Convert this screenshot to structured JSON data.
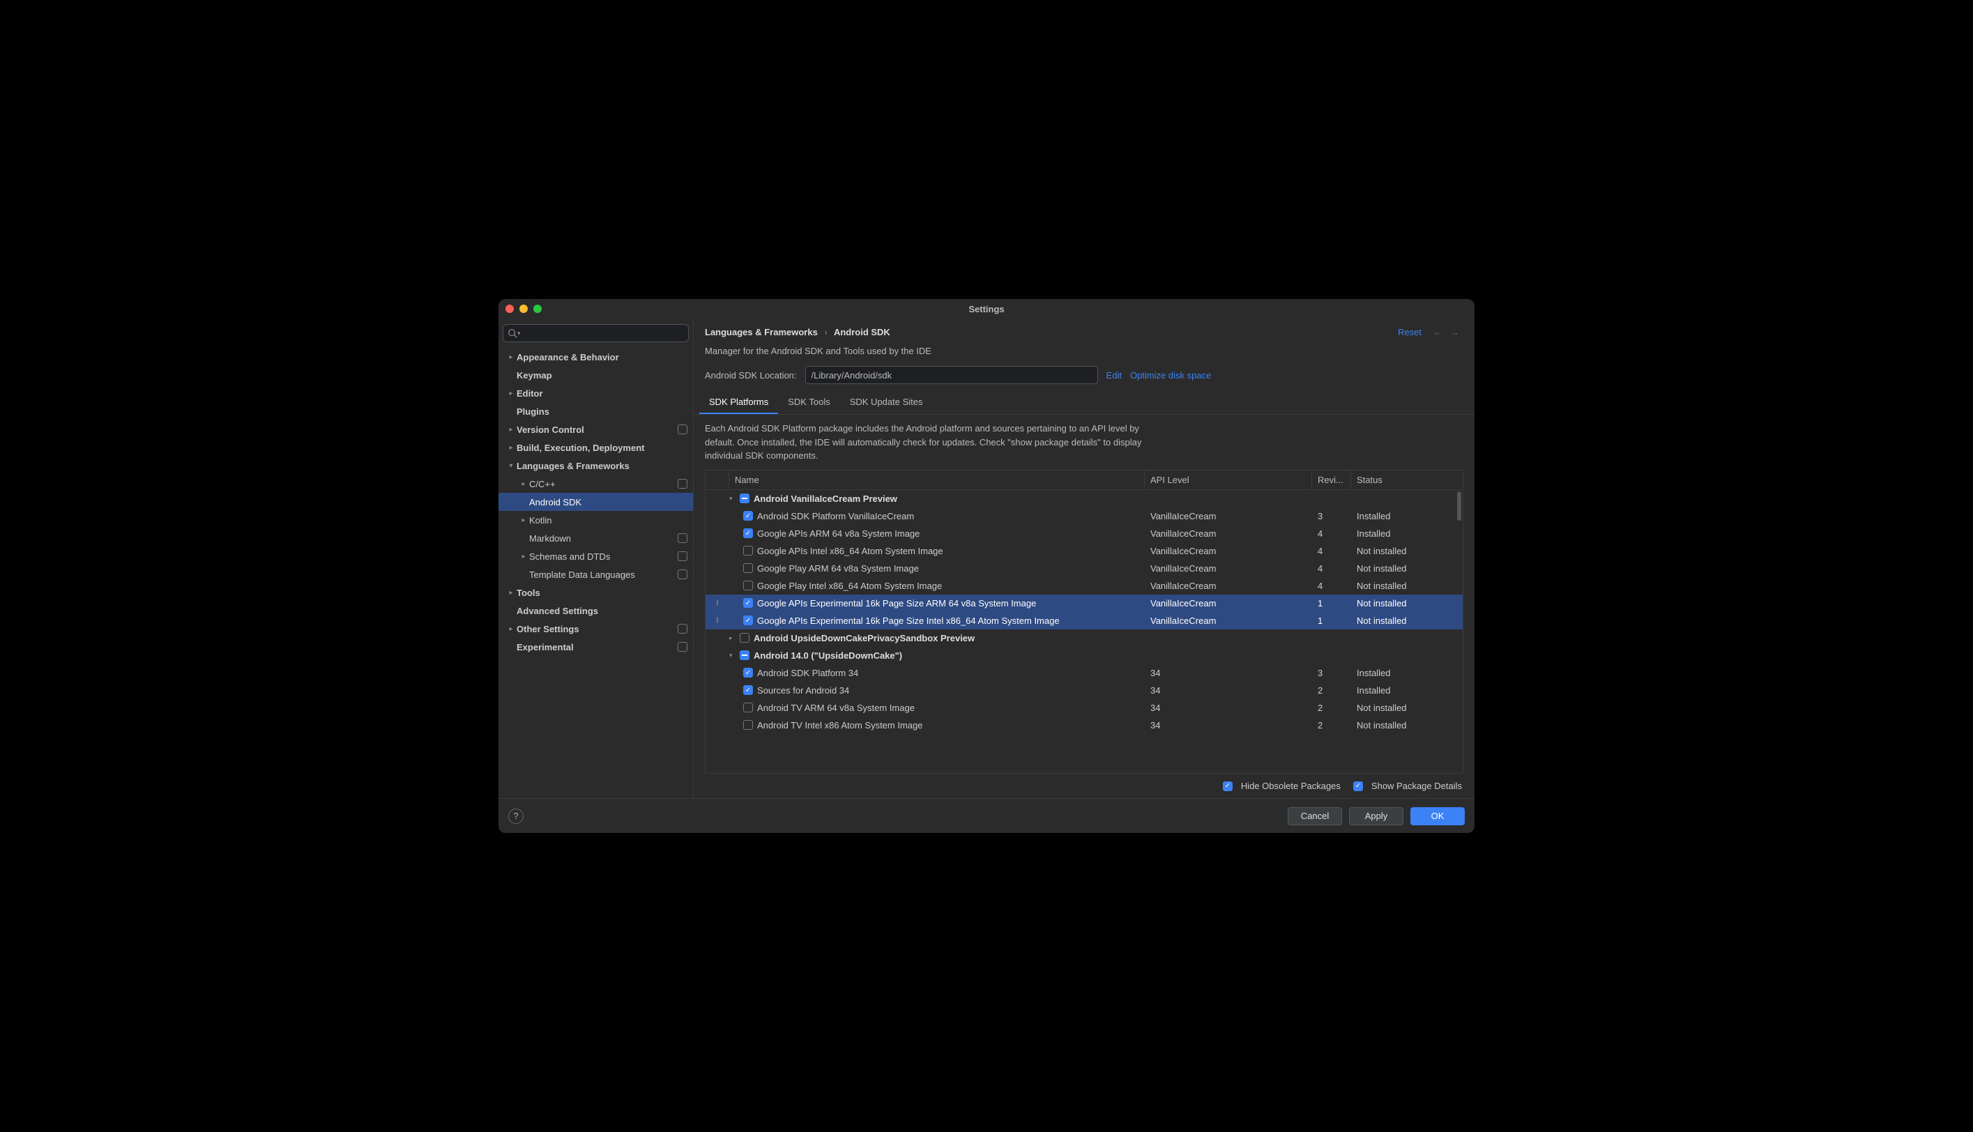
{
  "window": {
    "title": "Settings"
  },
  "search": {
    "placeholder": ""
  },
  "sidebar": {
    "items": [
      {
        "label": "Appearance & Behavior",
        "indent": 0,
        "arrow": ">",
        "bold": true
      },
      {
        "label": "Keymap",
        "indent": 0,
        "arrow": "",
        "bold": true
      },
      {
        "label": "Editor",
        "indent": 0,
        "arrow": ">",
        "bold": true
      },
      {
        "label": "Plugins",
        "indent": 0,
        "arrow": "",
        "bold": true
      },
      {
        "label": "Version Control",
        "indent": 0,
        "arrow": ">",
        "bold": true,
        "mod": true
      },
      {
        "label": "Build, Execution, Deployment",
        "indent": 0,
        "arrow": ">",
        "bold": true
      },
      {
        "label": "Languages & Frameworks",
        "indent": 0,
        "arrow": "v",
        "bold": true
      },
      {
        "label": "C/C++",
        "indent": 1,
        "arrow": ">",
        "mod": true
      },
      {
        "label": "Android SDK",
        "indent": 1,
        "arrow": "",
        "selected": true
      },
      {
        "label": "Kotlin",
        "indent": 1,
        "arrow": ">"
      },
      {
        "label": "Markdown",
        "indent": 1,
        "arrow": "",
        "mod": true
      },
      {
        "label": "Schemas and DTDs",
        "indent": 1,
        "arrow": ">",
        "mod": true
      },
      {
        "label": "Template Data Languages",
        "indent": 1,
        "arrow": "",
        "mod": true
      },
      {
        "label": "Tools",
        "indent": 0,
        "arrow": ">",
        "bold": true
      },
      {
        "label": "Advanced Settings",
        "indent": 0,
        "arrow": "",
        "bold": true
      },
      {
        "label": "Other Settings",
        "indent": 0,
        "arrow": ">",
        "bold": true,
        "mod": true
      },
      {
        "label": "Experimental",
        "indent": 0,
        "arrow": "",
        "bold": true,
        "mod": true
      }
    ]
  },
  "breadcrumb": {
    "a": "Languages & Frameworks",
    "b": "Android SDK"
  },
  "reset_label": "Reset",
  "manager_desc": "Manager for the Android SDK and Tools used by the IDE",
  "sdk_location": {
    "label": "Android SDK Location:",
    "value": "/Library/Android/sdk",
    "edit": "Edit",
    "optimize": "Optimize disk space"
  },
  "tabs": [
    "SDK Platforms",
    "SDK Tools",
    "SDK Update Sites"
  ],
  "active_tab": 0,
  "info_text": "Each Android SDK Platform package includes the Android platform and sources pertaining to an API level by default. Once installed, the IDE will automatically check for updates. Check \"show package details\" to display individual SDK components.",
  "columns": {
    "name": "Name",
    "api": "API Level",
    "rev": "Revi...",
    "status": "Status"
  },
  "rows": [
    {
      "type": "group",
      "arrow": "v",
      "cb": "partial",
      "name": "Android VanillaIceCream Preview"
    },
    {
      "type": "item",
      "cb": "checked",
      "name": "Android SDK Platform VanillaIceCream",
      "api": "VanillaIceCream",
      "rev": "3",
      "status": "Installed"
    },
    {
      "type": "item",
      "cb": "checked",
      "name": "Google APIs ARM 64 v8a System Image",
      "api": "VanillaIceCream",
      "rev": "4",
      "status": "Installed"
    },
    {
      "type": "item",
      "cb": "",
      "name": "Google APIs Intel x86_64 Atom System Image",
      "api": "VanillaIceCream",
      "rev": "4",
      "status": "Not installed"
    },
    {
      "type": "item",
      "cb": "",
      "name": "Google Play ARM 64 v8a System Image",
      "api": "VanillaIceCream",
      "rev": "4",
      "status": "Not installed"
    },
    {
      "type": "item",
      "cb": "",
      "name": "Google Play Intel x86_64 Atom System Image",
      "api": "VanillaIceCream",
      "rev": "4",
      "status": "Not installed"
    },
    {
      "type": "item",
      "cb": "checked",
      "name": "Google APIs Experimental 16k Page Size ARM 64 v8a System Image",
      "api": "VanillaIceCream",
      "rev": "1",
      "status": "Not installed",
      "dl": true,
      "selected": true
    },
    {
      "type": "item",
      "cb": "checked",
      "name": "Google APIs Experimental 16k Page Size Intel x86_64 Atom System Image",
      "api": "VanillaIceCream",
      "rev": "1",
      "status": "Not installed",
      "dl": true,
      "selected": true
    },
    {
      "type": "group",
      "arrow": ">",
      "cb": "",
      "name": "Android UpsideDownCakePrivacySandbox Preview"
    },
    {
      "type": "group",
      "arrow": "v",
      "cb": "partial",
      "name": "Android 14.0 (\"UpsideDownCake\")"
    },
    {
      "type": "item",
      "cb": "checked",
      "name": "Android SDK Platform 34",
      "api": "34",
      "rev": "3",
      "status": "Installed"
    },
    {
      "type": "item",
      "cb": "checked",
      "name": "Sources for Android 34",
      "api": "34",
      "rev": "2",
      "status": "Installed"
    },
    {
      "type": "item",
      "cb": "",
      "name": "Android TV ARM 64 v8a System Image",
      "api": "34",
      "rev": "2",
      "status": "Not installed"
    },
    {
      "type": "item",
      "cb": "",
      "name": "Android TV Intel x86 Atom System Image",
      "api": "34",
      "rev": "2",
      "status": "Not installed"
    }
  ],
  "options": {
    "hide": "Hide Obsolete Packages",
    "details": "Show Package Details"
  },
  "buttons": {
    "cancel": "Cancel",
    "apply": "Apply",
    "ok": "OK"
  }
}
